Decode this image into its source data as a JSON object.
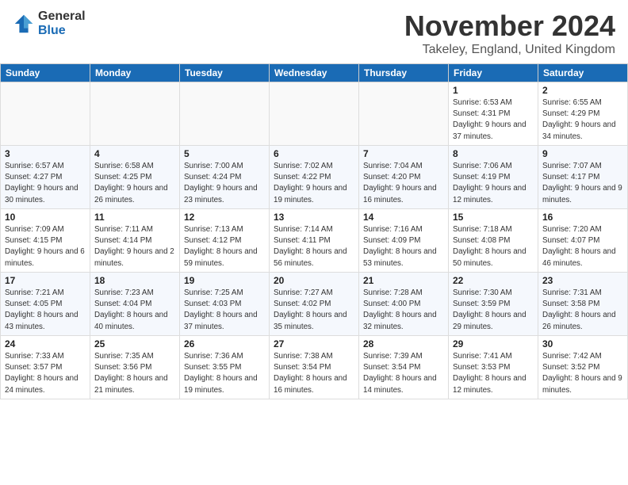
{
  "header": {
    "logo_general": "General",
    "logo_blue": "Blue",
    "month_year": "November 2024",
    "location": "Takeley, England, United Kingdom"
  },
  "weekdays": [
    "Sunday",
    "Monday",
    "Tuesday",
    "Wednesday",
    "Thursday",
    "Friday",
    "Saturday"
  ],
  "weeks": [
    [
      {
        "day": "",
        "empty": true
      },
      {
        "day": "",
        "empty": true
      },
      {
        "day": "",
        "empty": true
      },
      {
        "day": "",
        "empty": true
      },
      {
        "day": "",
        "empty": true
      },
      {
        "day": "1",
        "sunrise": "6:53 AM",
        "sunset": "4:31 PM",
        "daylight": "9 hours and 37 minutes."
      },
      {
        "day": "2",
        "sunrise": "6:55 AM",
        "sunset": "4:29 PM",
        "daylight": "9 hours and 34 minutes."
      }
    ],
    [
      {
        "day": "3",
        "sunrise": "6:57 AM",
        "sunset": "4:27 PM",
        "daylight": "9 hours and 30 minutes."
      },
      {
        "day": "4",
        "sunrise": "6:58 AM",
        "sunset": "4:25 PM",
        "daylight": "9 hours and 26 minutes."
      },
      {
        "day": "5",
        "sunrise": "7:00 AM",
        "sunset": "4:24 PM",
        "daylight": "9 hours and 23 minutes."
      },
      {
        "day": "6",
        "sunrise": "7:02 AM",
        "sunset": "4:22 PM",
        "daylight": "9 hours and 19 minutes."
      },
      {
        "day": "7",
        "sunrise": "7:04 AM",
        "sunset": "4:20 PM",
        "daylight": "9 hours and 16 minutes."
      },
      {
        "day": "8",
        "sunrise": "7:06 AM",
        "sunset": "4:19 PM",
        "daylight": "9 hours and 12 minutes."
      },
      {
        "day": "9",
        "sunrise": "7:07 AM",
        "sunset": "4:17 PM",
        "daylight": "9 hours and 9 minutes."
      }
    ],
    [
      {
        "day": "10",
        "sunrise": "7:09 AM",
        "sunset": "4:15 PM",
        "daylight": "9 hours and 6 minutes."
      },
      {
        "day": "11",
        "sunrise": "7:11 AM",
        "sunset": "4:14 PM",
        "daylight": "9 hours and 2 minutes."
      },
      {
        "day": "12",
        "sunrise": "7:13 AM",
        "sunset": "4:12 PM",
        "daylight": "8 hours and 59 minutes."
      },
      {
        "day": "13",
        "sunrise": "7:14 AM",
        "sunset": "4:11 PM",
        "daylight": "8 hours and 56 minutes."
      },
      {
        "day": "14",
        "sunrise": "7:16 AM",
        "sunset": "4:09 PM",
        "daylight": "8 hours and 53 minutes."
      },
      {
        "day": "15",
        "sunrise": "7:18 AM",
        "sunset": "4:08 PM",
        "daylight": "8 hours and 50 minutes."
      },
      {
        "day": "16",
        "sunrise": "7:20 AM",
        "sunset": "4:07 PM",
        "daylight": "8 hours and 46 minutes."
      }
    ],
    [
      {
        "day": "17",
        "sunrise": "7:21 AM",
        "sunset": "4:05 PM",
        "daylight": "8 hours and 43 minutes."
      },
      {
        "day": "18",
        "sunrise": "7:23 AM",
        "sunset": "4:04 PM",
        "daylight": "8 hours and 40 minutes."
      },
      {
        "day": "19",
        "sunrise": "7:25 AM",
        "sunset": "4:03 PM",
        "daylight": "8 hours and 37 minutes."
      },
      {
        "day": "20",
        "sunrise": "7:27 AM",
        "sunset": "4:02 PM",
        "daylight": "8 hours and 35 minutes."
      },
      {
        "day": "21",
        "sunrise": "7:28 AM",
        "sunset": "4:00 PM",
        "daylight": "8 hours and 32 minutes."
      },
      {
        "day": "22",
        "sunrise": "7:30 AM",
        "sunset": "3:59 PM",
        "daylight": "8 hours and 29 minutes."
      },
      {
        "day": "23",
        "sunrise": "7:31 AM",
        "sunset": "3:58 PM",
        "daylight": "8 hours and 26 minutes."
      }
    ],
    [
      {
        "day": "24",
        "sunrise": "7:33 AM",
        "sunset": "3:57 PM",
        "daylight": "8 hours and 24 minutes."
      },
      {
        "day": "25",
        "sunrise": "7:35 AM",
        "sunset": "3:56 PM",
        "daylight": "8 hours and 21 minutes."
      },
      {
        "day": "26",
        "sunrise": "7:36 AM",
        "sunset": "3:55 PM",
        "daylight": "8 hours and 19 minutes."
      },
      {
        "day": "27",
        "sunrise": "7:38 AM",
        "sunset": "3:54 PM",
        "daylight": "8 hours and 16 minutes."
      },
      {
        "day": "28",
        "sunrise": "7:39 AM",
        "sunset": "3:54 PM",
        "daylight": "8 hours and 14 minutes."
      },
      {
        "day": "29",
        "sunrise": "7:41 AM",
        "sunset": "3:53 PM",
        "daylight": "8 hours and 12 minutes."
      },
      {
        "day": "30",
        "sunrise": "7:42 AM",
        "sunset": "3:52 PM",
        "daylight": "8 hours and 9 minutes."
      }
    ]
  ]
}
